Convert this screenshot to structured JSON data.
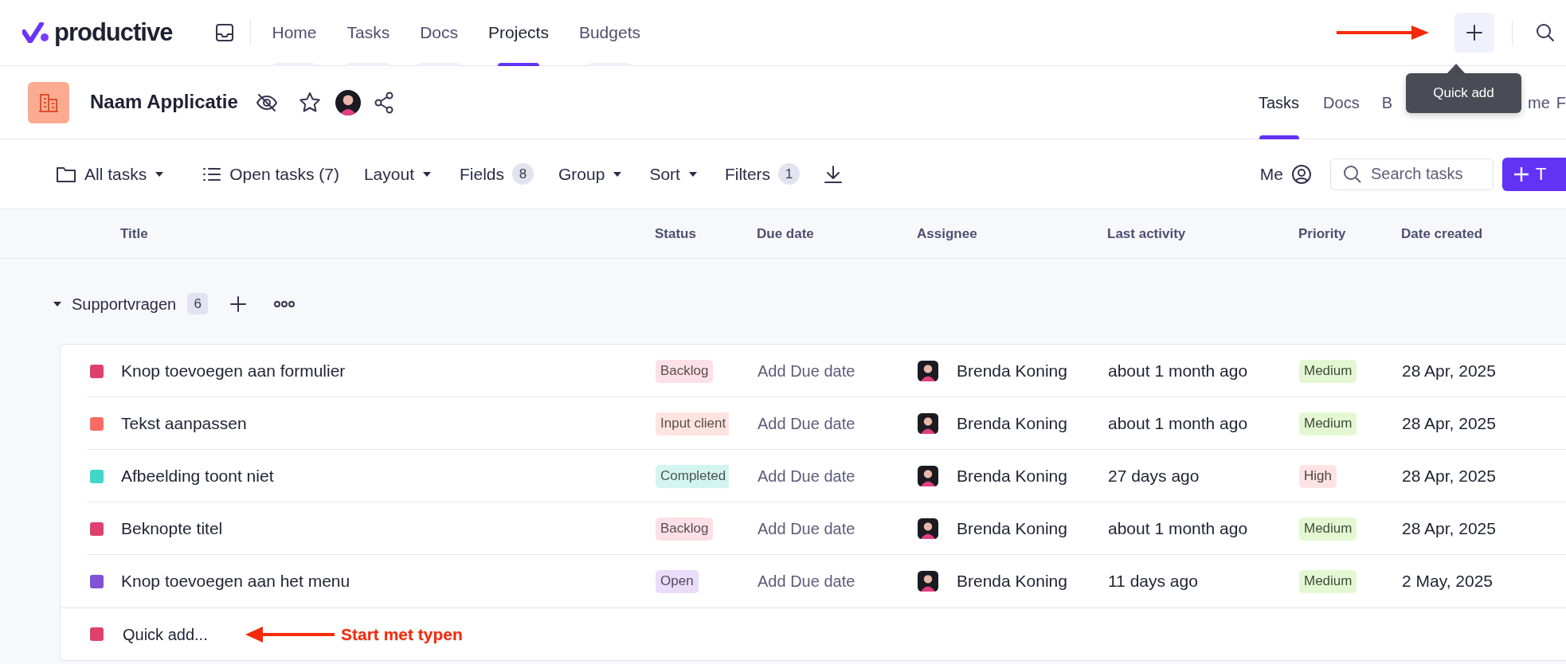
{
  "brand": {
    "name": "productive"
  },
  "nav": [
    {
      "label": "Home",
      "selected": false
    },
    {
      "label": "Tasks",
      "selected": false
    },
    {
      "label": "Docs",
      "selected": false
    },
    {
      "label": "Projects",
      "selected": true
    },
    {
      "label": "Budgets",
      "selected": false
    }
  ],
  "quick_add_tooltip": "Quick add",
  "project": {
    "title": "Naam Applicatie",
    "tabs": [
      {
        "label": "Tasks",
        "selected": true
      },
      {
        "label": "Docs",
        "selected": false
      },
      {
        "label": "B",
        "selected": false
      },
      {
        "label": "me",
        "selected": false
      },
      {
        "label": "F",
        "selected": false
      }
    ]
  },
  "toolbar": {
    "items": [
      {
        "kind": "dropdown",
        "label": "All tasks"
      },
      {
        "kind": "plain",
        "label": "Open tasks (7)"
      },
      {
        "kind": "dropdown",
        "label": "Layout"
      },
      {
        "kind": "count",
        "label": "Fields",
        "count": "8"
      },
      {
        "kind": "dropdown",
        "label": "Group"
      },
      {
        "kind": "dropdown",
        "label": "Sort"
      },
      {
        "kind": "count",
        "label": "Filters",
        "count": "1"
      }
    ],
    "me": "Me",
    "search_placeholder": "Search tasks",
    "new_button": "T"
  },
  "table": {
    "columns": [
      "Title",
      "Status",
      "Due date",
      "Assignee",
      "Last activity",
      "Priority",
      "Date created"
    ],
    "group": {
      "name": "Supportvragen",
      "count": "6",
      "expanded": true
    },
    "rows": [
      {
        "color": "#e0406f",
        "title": "Knop toevoegen aan formulier",
        "status": {
          "label": "Backlog",
          "color": "#fde0e7"
        },
        "due": "Add Due date",
        "assignee": "Brenda Koning",
        "last_activity": "about 1 month ago",
        "priority": {
          "label": "Medium",
          "color": "#e3f8d2"
        },
        "created": "28 Apr, 2025"
      },
      {
        "color": "#fa6b63",
        "title": "Tekst aanpassen",
        "status": {
          "label": "Input client",
          "color": "#fde4e1"
        },
        "due": "Add Due date",
        "assignee": "Brenda Koning",
        "last_activity": "about 1 month ago",
        "priority": {
          "label": "Medium",
          "color": "#e3f8d2"
        },
        "created": "28 Apr, 2025"
      },
      {
        "color": "#3fd7c9",
        "title": "Afbeelding toont niet",
        "status": {
          "label": "Completed",
          "color": "#d4f5ef"
        },
        "due": "Add Due date",
        "assignee": "Brenda Koning",
        "last_activity": "27 days ago",
        "priority": {
          "label": "High",
          "color": "#fde3e3"
        },
        "created": "28 Apr, 2025"
      },
      {
        "color": "#e0406f",
        "title": "Beknopte titel",
        "status": {
          "label": "Backlog",
          "color": "#fde0e7"
        },
        "due": "Add Due date",
        "assignee": "Brenda Koning",
        "last_activity": "about 1 month ago",
        "priority": {
          "label": "Medium",
          "color": "#e3f8d2"
        },
        "created": "28 Apr, 2025"
      },
      {
        "color": "#8152d6",
        "title": "Knop toevoegen aan het menu",
        "status": {
          "label": "Open",
          "color": "#eadcfb"
        },
        "due": "Add Due date",
        "assignee": "Brenda Koning",
        "last_activity": "11 days ago",
        "priority": {
          "label": "Medium",
          "color": "#e3f8d2"
        },
        "created": "2 May, 2025"
      }
    ],
    "quick_add": {
      "placeholder": "Quick add...",
      "color": "#e0406f"
    }
  },
  "annotation": {
    "text": "Start met typen"
  }
}
